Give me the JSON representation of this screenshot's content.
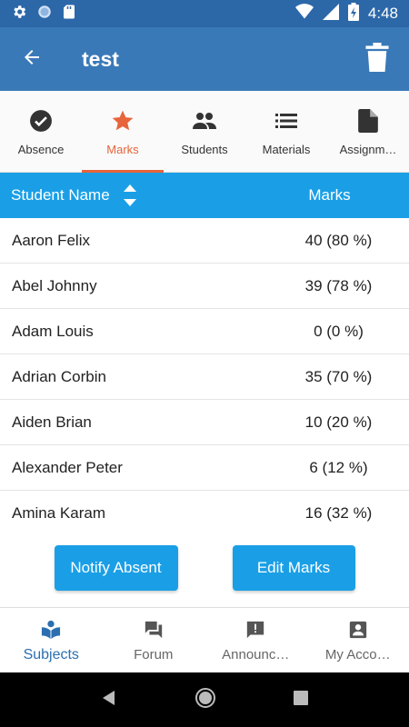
{
  "status_bar": {
    "time": "4:48",
    "left_icons": [
      "settings-icon",
      "circle-icon",
      "sd-card-icon"
    ],
    "right_icons": [
      "wifi-icon",
      "signal-icon",
      "battery-icon"
    ]
  },
  "app_bar": {
    "title": "test",
    "back_icon": "arrow-left-icon",
    "delete_icon": "trash-icon",
    "color": "#3a79b8"
  },
  "tabs": [
    {
      "label": "Absence",
      "icon": "check-circle-icon",
      "active": false
    },
    {
      "label": "Marks",
      "icon": "star-icon",
      "active": true
    },
    {
      "label": "Students",
      "icon": "people-icon",
      "active": false
    },
    {
      "label": "Materials",
      "icon": "list-icon",
      "active": false
    },
    {
      "label": "Assignm…",
      "icon": "document-icon",
      "active": false
    }
  ],
  "table": {
    "header_name": "Student Name",
    "header_marks": "Marks",
    "header_color": "#1a9fe6",
    "rows": [
      {
        "name": "Aaron Felix",
        "marks": "40 (80 %)"
      },
      {
        "name": "Abel Johnny",
        "marks": "39 (78 %)"
      },
      {
        "name": "Adam Louis",
        "marks": "0 (0 %)"
      },
      {
        "name": "Adrian Corbin",
        "marks": "35 (70 %)"
      },
      {
        "name": "Aiden Brian",
        "marks": "10 (20 %)"
      },
      {
        "name": "Alexander Peter",
        "marks": "6 (12 %)"
      },
      {
        "name": "Amina Karam",
        "marks": "16 (32 %)"
      }
    ]
  },
  "actions": {
    "notify_label": "Notify Absent",
    "edit_label": "Edit Marks"
  },
  "bottom_nav": [
    {
      "label": "Subjects",
      "icon": "book-icon",
      "active": true
    },
    {
      "label": "Forum",
      "icon": "forum-icon",
      "active": false
    },
    {
      "label": "Announc…",
      "icon": "announcement-icon",
      "active": false
    },
    {
      "label": "My Acco…",
      "icon": "account-icon",
      "active": false
    }
  ],
  "accent_color": "#e8643a"
}
